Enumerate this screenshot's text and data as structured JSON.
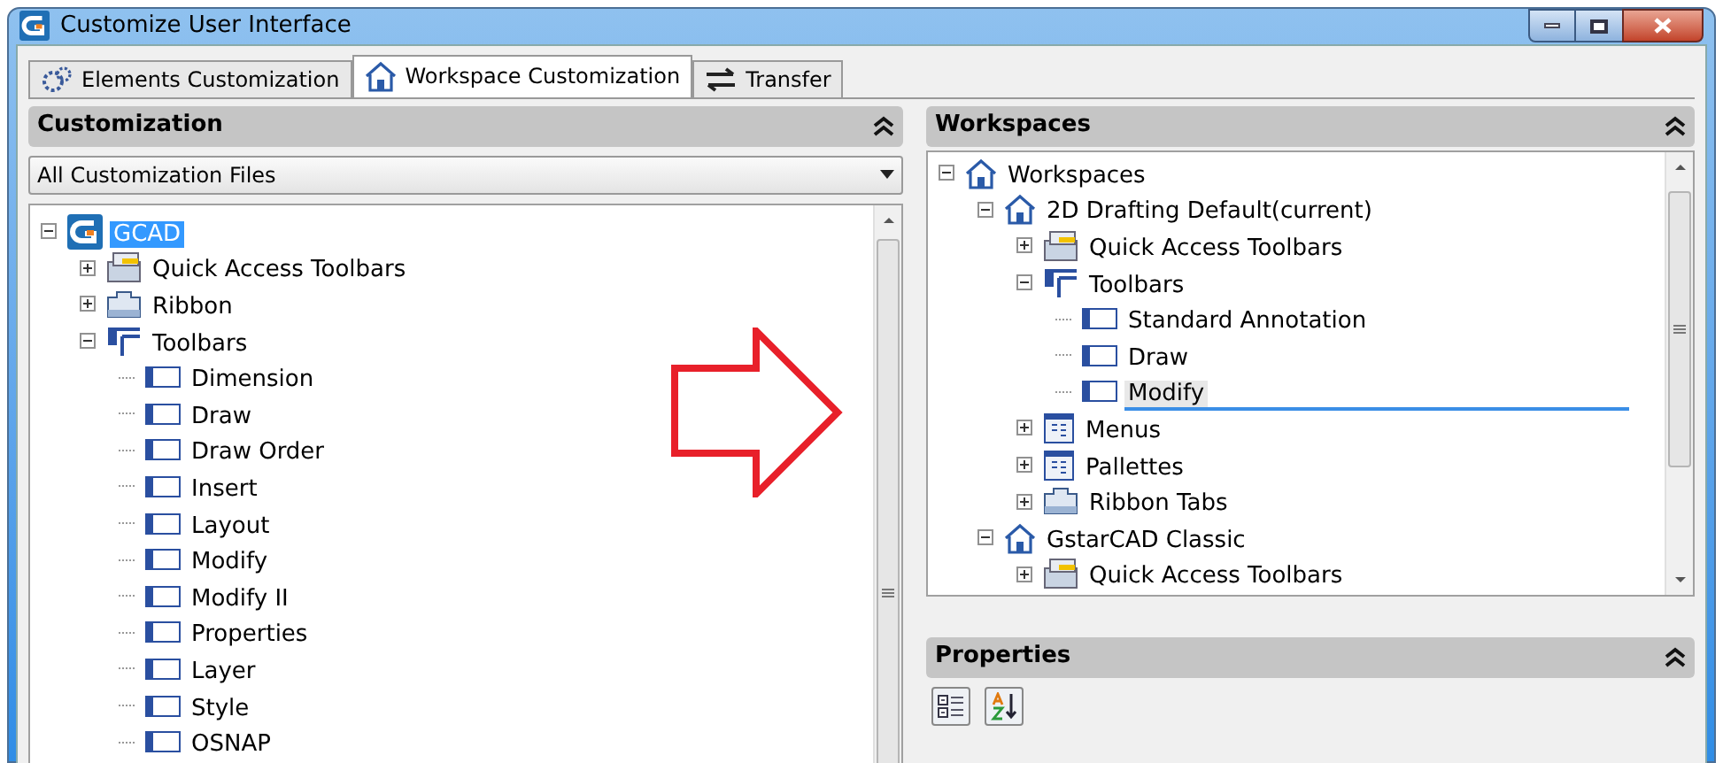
{
  "window": {
    "title": "Customize User Interface"
  },
  "tabs": [
    {
      "label": "Elements Customization",
      "kind": "gears",
      "selected": false
    },
    {
      "label": "Workspace Customization",
      "kind": "house",
      "selected": true
    },
    {
      "label": "Transfer",
      "kind": "arrows",
      "selected": false
    }
  ],
  "customization": {
    "title": "Customization",
    "filter": {
      "value": "All Customization Files"
    },
    "tree": [
      {
        "label": "GCAD",
        "kind": "app",
        "selected": true,
        "expanded": true,
        "children": [
          {
            "label": "Quick Access Toolbars",
            "kind": "qat",
            "expanded": false
          },
          {
            "label": "Ribbon",
            "kind": "ribbon",
            "expanded": false
          },
          {
            "label": "Toolbars",
            "kind": "toolbars",
            "expanded": true,
            "children": [
              {
                "label": "Dimension",
                "kind": "toolbar"
              },
              {
                "label": "Draw",
                "kind": "toolbar"
              },
              {
                "label": "Draw Order",
                "kind": "toolbar"
              },
              {
                "label": "Insert",
                "kind": "toolbar"
              },
              {
                "label": "Layout",
                "kind": "toolbar"
              },
              {
                "label": "Modify",
                "kind": "toolbar"
              },
              {
                "label": "Modify II",
                "kind": "toolbar"
              },
              {
                "label": "Properties",
                "kind": "toolbar"
              },
              {
                "label": "Layer",
                "kind": "toolbar"
              },
              {
                "label": "Style",
                "kind": "toolbar"
              },
              {
                "label": "OSNAP",
                "kind": "toolbar"
              }
            ]
          }
        ]
      }
    ]
  },
  "workspaces": {
    "title": "Workspaces",
    "tree": [
      {
        "label": "Workspaces",
        "kind": "workspace",
        "expanded": true,
        "children": [
          {
            "label": "2D Drafting Default(current)",
            "kind": "workspace",
            "expanded": true,
            "children": [
              {
                "label": "Quick Access Toolbars",
                "kind": "qat",
                "expanded": false
              },
              {
                "label": "Toolbars",
                "kind": "toolbars",
                "expanded": true,
                "children": [
                  {
                    "label": "Standard Annotation",
                    "kind": "toolbar"
                  },
                  {
                    "label": "Draw",
                    "kind": "toolbar"
                  },
                  {
                    "label": "Modify",
                    "kind": "toolbar",
                    "drop_target": true
                  }
                ]
              },
              {
                "label": "Menus",
                "kind": "menus",
                "expanded": false
              },
              {
                "label": "Pallettes",
                "kind": "menus",
                "expanded": false
              },
              {
                "label": "Ribbon Tabs",
                "kind": "ribbon",
                "expanded": false
              }
            ]
          },
          {
            "label": "GstarCAD Classic",
            "kind": "workspace",
            "expanded": true,
            "children": [
              {
                "label": "Quick Access Toolbars",
                "kind": "qat",
                "expanded": false
              }
            ]
          }
        ]
      }
    ]
  },
  "properties": {
    "title": "Properties",
    "buttons": [
      {
        "kind": "categorized"
      },
      {
        "kind": "alphabetical"
      }
    ]
  }
}
